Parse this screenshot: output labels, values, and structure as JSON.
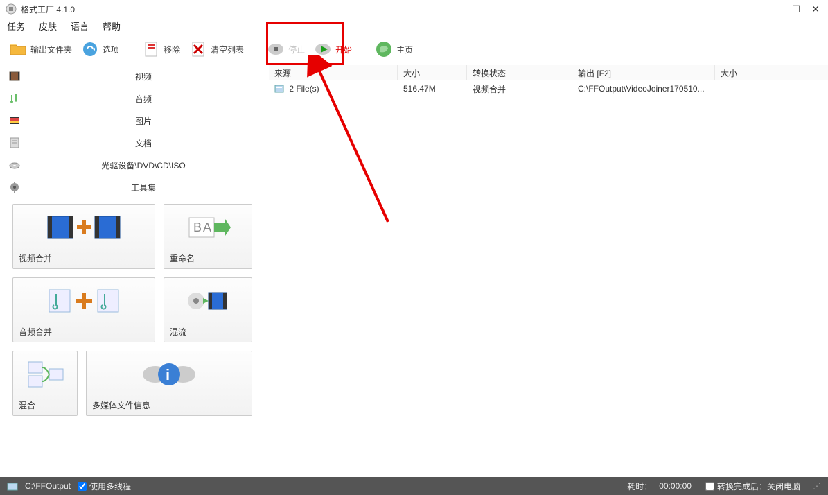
{
  "title": "格式工厂 4.1.0",
  "menu": [
    "任务",
    "皮肤",
    "语言",
    "帮助"
  ],
  "toolbar": {
    "output_folder": "输出文件夹",
    "options": "选项",
    "remove": "移除",
    "clear_list": "清空列表",
    "stop": "停止",
    "start": "开始",
    "home": "主页"
  },
  "categories": [
    {
      "label": "视频"
    },
    {
      "label": "音频"
    },
    {
      "label": "图片"
    },
    {
      "label": "文档"
    },
    {
      "label": "光驱设备\\DVD\\CD\\ISO"
    },
    {
      "label": "工具集"
    }
  ],
  "tools": {
    "video_join": "视频合并",
    "rename": "重命名",
    "audio_join": "音频合并",
    "mux": "混流",
    "mix": "混合",
    "media_info": "多媒体文件信息"
  },
  "columns": {
    "source": "来源",
    "size": "大小",
    "status": "转换状态",
    "output": "输出 [F2]",
    "size2": "大小"
  },
  "row": {
    "source": "2 File(s)",
    "size": "516.47M",
    "status": "视频合并",
    "output": "C:\\FFOutput\\VideoJoiner170510..."
  },
  "status_bar": {
    "path": "C:\\FFOutput",
    "multithread": "使用多线程",
    "elapsed_label": "耗时：",
    "elapsed_value": "00:00:00",
    "after_label": "转换完成后：",
    "after_value": "关闭电脑"
  }
}
